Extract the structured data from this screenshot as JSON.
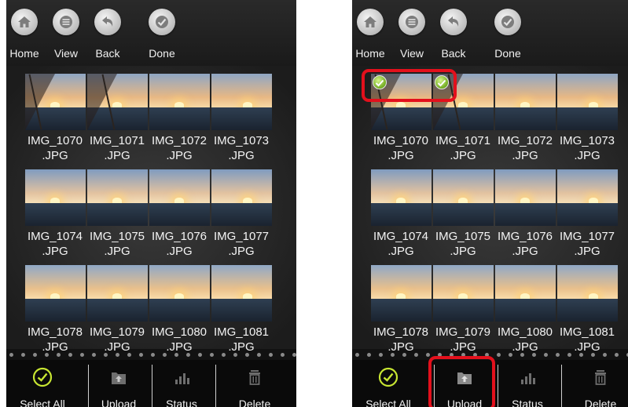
{
  "toolbar": {
    "home_label": "Home",
    "view_label": "View",
    "back_label": "Back",
    "done_label": "Done"
  },
  "files": [
    "IMG_1070",
    "IMG_1071",
    "IMG_1072",
    "IMG_1073",
    "IMG_1074",
    "IMG_1075",
    "IMG_1076",
    "IMG_1077",
    "IMG_1078",
    "IMG_1079",
    "IMG_1080",
    "IMG_1081"
  ],
  "extension": ".JPG",
  "bottom": {
    "select_all_label": "Select All",
    "upload_label": "Upload",
    "status_label": "Status",
    "delete_label": "Delete"
  },
  "selected_right_panel": [
    "IMG_1070",
    "IMG_1071"
  ],
  "colors": {
    "highlight": "#e3101c",
    "check": "#8cc63f",
    "select_all_icon": "#c8e632"
  }
}
